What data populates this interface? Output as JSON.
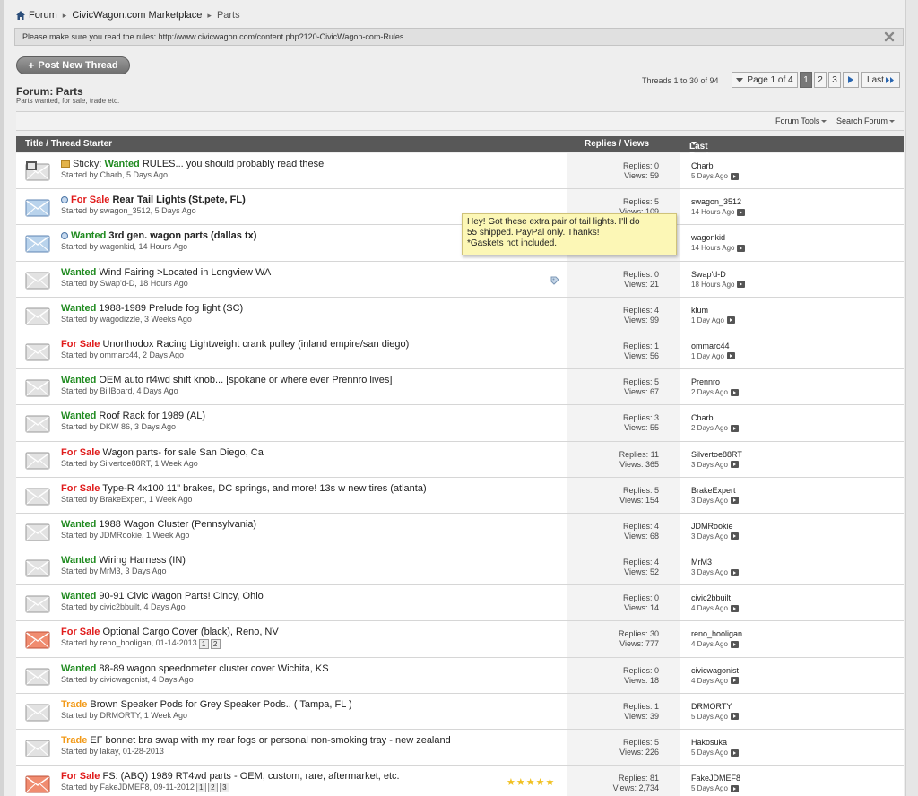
{
  "breadcrumb": {
    "items": [
      "Forum",
      "CivicWagon.com Marketplace",
      "Parts"
    ]
  },
  "notice": {
    "text": "Please make sure you read the rules: http://www.civicwagon.com/content.php?120-CivicWagon-com-Rules"
  },
  "actions": {
    "new_thread": "Post New Thread"
  },
  "forum": {
    "title": "Forum: Parts",
    "description": "Parts wanted, for sale, trade etc."
  },
  "pagination": {
    "threads_count": "Threads 1 to 30 of 94",
    "page_of": "Page 1 of 4",
    "pages": [
      "1",
      "2",
      "3"
    ],
    "last": "Last"
  },
  "tools": {
    "forum_tools": "Forum Tools",
    "search_forum": "Search Forum"
  },
  "columns": {
    "title": "Title / Thread Starter",
    "stats": "Replies / Views",
    "last_post": "Last Post By"
  },
  "tooltip": {
    "lines": [
      "Hey! Got these extra pair of tail lights. I'll do",
      "55 shipped. PayPal only. Thanks!",
      "*Gaskets not included."
    ]
  },
  "threads": [
    {
      "sticky": "Sticky:",
      "prefix": "Wanted",
      "prefix_type": "w",
      "title": "RULES... you should probably read these",
      "starter": "Started by Charb, 5 Days Ago",
      "replies": "Replies: 0",
      "views": "Views: 59",
      "last_user": "Charb",
      "last_time": "5 Days Ago",
      "icon": "locked"
    },
    {
      "prefix": "For Sale",
      "prefix_type": "s",
      "title": "Rear Tail Lights (St.pete, FL)",
      "starter": "Started by swagon_3512, 5 Days Ago",
      "replies": "Replies: 5",
      "views": "Views: 109",
      "last_user": "swagon_3512",
      "last_time": "14 Hours Ago",
      "icon": "new"
    },
    {
      "prefix": "Wanted",
      "prefix_type": "w",
      "title": "3rd gen. wagon parts (dallas tx)",
      "starter": "Started by wagonkid, 14 Hours Ago",
      "replies": "",
      "views": "",
      "last_user": "wagonkid",
      "last_time": "14 Hours Ago",
      "icon": "new"
    },
    {
      "prefix": "Wanted",
      "prefix_type": "w",
      "title": "Wind Fairing >Located in Longview WA",
      "starter": "Started by Swap'd-D, 18 Hours Ago",
      "replies": "Replies: 0",
      "views": "Views: 21",
      "last_user": "Swap'd-D",
      "last_time": "18 Hours Ago",
      "icon": "normal"
    },
    {
      "prefix": "Wanted",
      "prefix_type": "w",
      "title": "1988-1989 Prelude fog light (SC)",
      "starter": "Started by wagodizzle, 3 Weeks Ago",
      "replies": "Replies: 4",
      "views": "Views: 99",
      "last_user": "klum",
      "last_time": "1 Day Ago",
      "icon": "normal"
    },
    {
      "prefix": "For Sale",
      "prefix_type": "s",
      "title": "Unorthodox Racing Lightweight crank pulley (inland empire/san diego)",
      "starter": "Started by ommarc44, 2 Days Ago",
      "replies": "Replies: 1",
      "views": "Views: 56",
      "last_user": "ommarc44",
      "last_time": "1 Day Ago",
      "icon": "normal"
    },
    {
      "prefix": "Wanted",
      "prefix_type": "w",
      "title": "OEM auto rt4wd shift knob... [spokane or where ever Prennro lives]",
      "starter": "Started by BillBoard, 4 Days Ago",
      "replies": "Replies: 5",
      "views": "Views: 67",
      "last_user": "Prennro",
      "last_time": "2 Days Ago",
      "icon": "normal"
    },
    {
      "prefix": "Wanted",
      "prefix_type": "w",
      "title": "Roof Rack for 1989 (AL)",
      "starter": "Started by DKW 86, 3 Days Ago",
      "replies": "Replies: 3",
      "views": "Views: 55",
      "last_user": "Charb",
      "last_time": "2 Days Ago",
      "icon": "normal"
    },
    {
      "prefix": "For Sale",
      "prefix_type": "s",
      "title": "Wagon parts- for sale San Diego, Ca",
      "starter": "Started by Silvertoe88RT, 1 Week Ago",
      "replies": "Replies: 11",
      "views": "Views: 365",
      "last_user": "Silvertoe88RT",
      "last_time": "3 Days Ago",
      "icon": "normal"
    },
    {
      "prefix": "For Sale",
      "prefix_type": "s",
      "title": "Type-R 4x100 11\" brakes, DC springs, and more! 13s w new tires (atlanta)",
      "starter": "Started by BrakeExpert, 1 Week Ago",
      "replies": "Replies: 5",
      "views": "Views: 154",
      "last_user": "BrakeExpert",
      "last_time": "3 Days Ago",
      "icon": "normal"
    },
    {
      "prefix": "Wanted",
      "prefix_type": "w",
      "title": "1988 Wagon Cluster (Pennsylvania)",
      "starter": "Started by JDMRookie, 1 Week Ago",
      "replies": "Replies: 4",
      "views": "Views: 68",
      "last_user": "JDMRookie",
      "last_time": "3 Days Ago",
      "icon": "normal"
    },
    {
      "prefix": "Wanted",
      "prefix_type": "w",
      "title": "Wiring Harness (IN)",
      "starter": "Started by MrM3, 3 Days Ago",
      "replies": "Replies: 4",
      "views": "Views: 52",
      "last_user": "MrM3",
      "last_time": "3 Days Ago",
      "icon": "normal"
    },
    {
      "prefix": "Wanted",
      "prefix_type": "w",
      "title": "90-91 Civic Wagon Parts! Cincy, Ohio",
      "starter": "Started by civic2bbuilt, 4 Days Ago",
      "replies": "Replies: 0",
      "views": "Views: 14",
      "last_user": "civic2bbuilt",
      "last_time": "4 Days Ago",
      "icon": "normal"
    },
    {
      "prefix": "For Sale",
      "prefix_type": "s",
      "title": "Optional Cargo Cover (black), Reno, NV",
      "starter": "Started by reno_hooligan, 01-14-2013",
      "pages": [
        "1",
        "2"
      ],
      "replies": "Replies: 30",
      "views": "Views: 777",
      "last_user": "reno_hooligan",
      "last_time": "4 Days Ago",
      "icon": "hot"
    },
    {
      "prefix": "Wanted",
      "prefix_type": "w",
      "title": "88-89 wagon speedometer cluster cover Wichita, KS",
      "starter": "Started by civicwagonist, 4 Days Ago",
      "replies": "Replies: 0",
      "views": "Views: 18",
      "last_user": "civicwagonist",
      "last_time": "4 Days Ago",
      "icon": "normal"
    },
    {
      "prefix": "Trade",
      "prefix_type": "t",
      "title": "Brown Speaker Pods for Grey Speaker Pods.. ( Tampa, FL )",
      "starter": "Started by DRMORTY, 1 Week Ago",
      "replies": "Replies: 1",
      "views": "Views: 39",
      "last_user": "DRMORTY",
      "last_time": "5 Days Ago",
      "icon": "normal"
    },
    {
      "prefix": "Trade",
      "prefix_type": "t",
      "title": "EF bonnet bra swap with my rear fogs or personal non-smoking tray - new zealand",
      "starter": "Started by lakay, 01-28-2013",
      "replies": "Replies: 5",
      "views": "Views: 226",
      "last_user": "Hakosuka",
      "last_time": "5 Days Ago",
      "icon": "normal"
    },
    {
      "prefix": "For Sale",
      "prefix_type": "s",
      "title": "FS: (ABQ) 1989 RT4wd parts - OEM, custom, rare, aftermarket, etc.",
      "starter": "Started by FakeJDMEF8, 09-11-2012",
      "pages": [
        "1",
        "2",
        "3"
      ],
      "replies": "Replies: 81",
      "views": "Views: 2,734",
      "last_user": "FakeJDMEF8",
      "last_time": "5 Days Ago",
      "icon": "hot"
    }
  ]
}
